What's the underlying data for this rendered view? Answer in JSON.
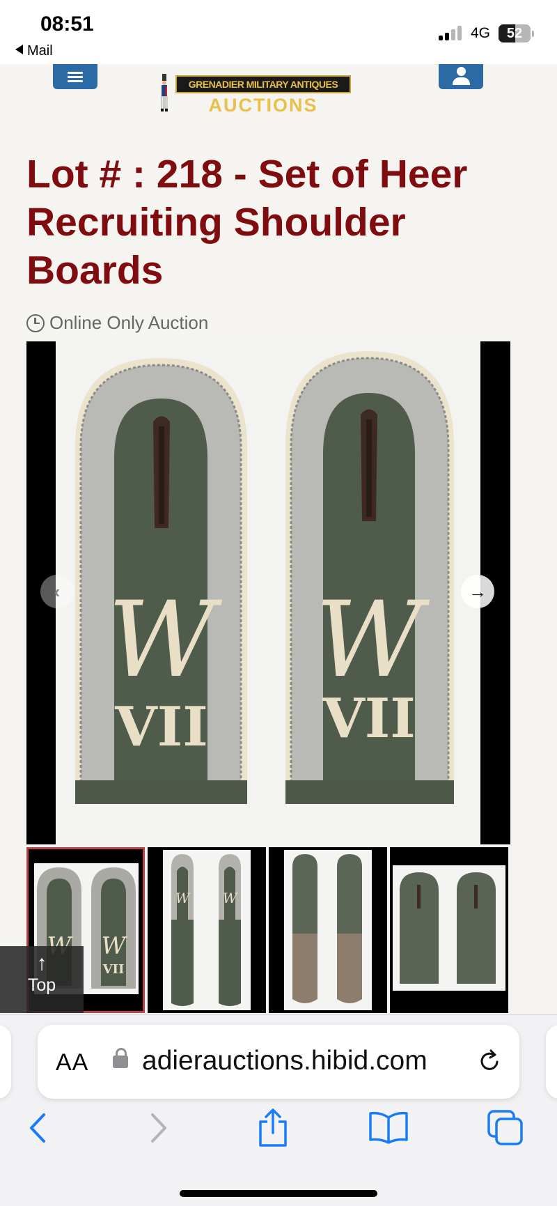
{
  "status_bar": {
    "time": "08:51",
    "back_app": "Mail",
    "network": "4G",
    "battery": "52",
    "battery_level": 0.52
  },
  "header": {
    "menu_icon": "hamburger-menu-icon",
    "account_icon": "user-icon",
    "logo_line1": "GRENADIER MILITARY ANTIQUES",
    "logo_line2": "AUCTIONS"
  },
  "lot": {
    "title": "Lot # : 218 - Set of Heer Recruiting Shoulder Boards",
    "auction_type": "Online Only Auction",
    "image_monogram": "W",
    "image_numeral": "VII"
  },
  "gallery": {
    "thumbnails": [
      {
        "alt": "thumbnail 1",
        "selected": true
      },
      {
        "alt": "thumbnail 2",
        "selected": false
      },
      {
        "alt": "thumbnail 3",
        "selected": false
      },
      {
        "alt": "thumbnail 4",
        "selected": false
      }
    ],
    "prev_icon": "chevron-left-icon",
    "next_icon": "chevron-right-icon"
  },
  "back_to_top": {
    "arrow": "↑",
    "label": "Top"
  },
  "browser": {
    "text_size_label": "AA",
    "url": "adierauctions.hibid.com",
    "toolbar_icons": [
      "back-icon",
      "forward-icon",
      "share-icon",
      "bookmarks-icon",
      "tabs-icon"
    ]
  },
  "colors": {
    "title": "#7f0d10",
    "header_button": "#2c6aa6",
    "ios_blue": "#1a7cf5",
    "selected_thumb_border": "#b5434a"
  }
}
